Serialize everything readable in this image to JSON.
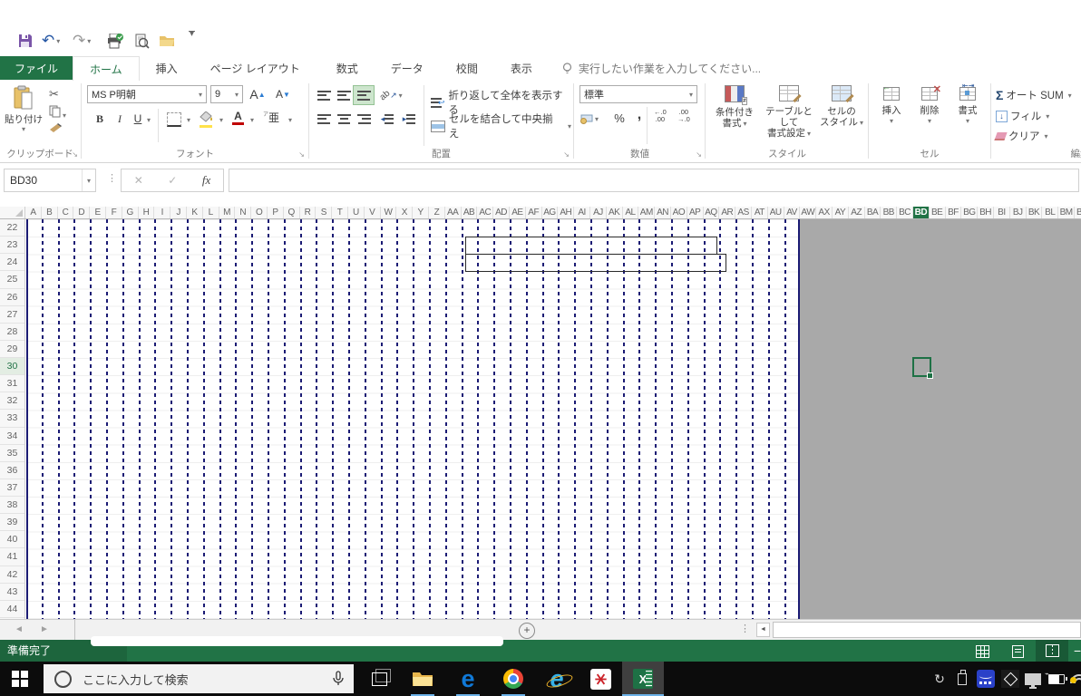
{
  "qat": {
    "icons": [
      "save-icon",
      "undo-icon",
      "redo-icon",
      "quick-print-icon",
      "print-preview-icon",
      "open-icon",
      "customize-qat-icon"
    ],
    "undo_glyph": "↶",
    "redo_glyph": "↷",
    "customize_glyph": "▾"
  },
  "ribbon_tabs": {
    "file": "ファイル",
    "home": "ホーム",
    "insert": "挿入",
    "page_layout": "ページ レイアウト",
    "formulas": "数式",
    "data": "データ",
    "review": "校閲",
    "view": "表示",
    "tell_me": "実行したい作業を入力してください..."
  },
  "ribbon": {
    "clipboard": {
      "label": "クリップボード",
      "paste": "貼り付け"
    },
    "font": {
      "label": "フォント",
      "family": "MS P明朝",
      "size": "9",
      "bold": "B",
      "italic": "I",
      "underline": "U",
      "grow": "A",
      "shrink": "A",
      "color_letter": "A",
      "phonetic": "亜"
    },
    "alignment": {
      "label": "配置",
      "orientation": "ab",
      "wrap": "折り返して全体を表示する",
      "merge": "セルを結合して中央揃え"
    },
    "number": {
      "label": "数値",
      "format": "標準",
      "percent": "%",
      "comma": ",",
      "inc_top": "←.0",
      "inc_bottom": ".00",
      "dec_top": ".00",
      "dec_bottom": "→.0"
    },
    "styles": {
      "label": "スタイル",
      "conditional_1": "条件付き",
      "conditional_2": "書式",
      "table_1": "テーブルとして",
      "table_2": "書式設定",
      "cell_1": "セルの",
      "cell_2": "スタイル"
    },
    "cells": {
      "label": "セル",
      "insert": "挿入",
      "delete": "削除",
      "format": "書式"
    },
    "editing": {
      "label": "編集",
      "sigma": "Σ",
      "autosum": "オート SUM",
      "fill": "フィル",
      "clear": "クリア"
    }
  },
  "formula_bar": {
    "name_box": "BD30",
    "cancel": "✕",
    "enter": "✓",
    "fx": "fx",
    "value": ""
  },
  "grid": {
    "selected_cell": "BD30",
    "selected_column": "BD",
    "selected_row": 30,
    "columns": [
      "A",
      "B",
      "C",
      "D",
      "E",
      "F",
      "G",
      "H",
      "I",
      "J",
      "K",
      "L",
      "M",
      "N",
      "O",
      "P",
      "Q",
      "R",
      "S",
      "T",
      "U",
      "V",
      "W",
      "X",
      "Y",
      "Z",
      "AA",
      "AB",
      "AC",
      "AD",
      "AE",
      "AF",
      "AG",
      "AH",
      "AI",
      "AJ",
      "AK",
      "AL",
      "AM",
      "AN",
      "AO",
      "AP",
      "AQ",
      "AR",
      "AS",
      "AT",
      "AU",
      "AV",
      "AW",
      "AX",
      "AY",
      "AZ",
      "BA",
      "BB",
      "BC",
      "BD",
      "BE",
      "BF",
      "BG",
      "BH",
      "BI",
      "BJ",
      "BK",
      "BL",
      "BM",
      "BN"
    ],
    "rows": [
      22,
      23,
      24,
      25,
      26,
      27,
      28,
      29,
      30,
      31,
      32,
      33,
      34,
      35,
      36,
      37,
      38,
      39,
      40,
      41,
      42,
      43,
      44
    ]
  },
  "sheet_tabs": {
    "scroll_left": "◄",
    "scroll_right": "►",
    "new_sheet": "+",
    "hscroll_left": "◄"
  },
  "status_bar": {
    "ready": "準備完了",
    "zoom_out": "−"
  },
  "taskbar": {
    "search_placeholder": "ここに入力して検索",
    "tray_sync_glyph": "↻"
  }
}
